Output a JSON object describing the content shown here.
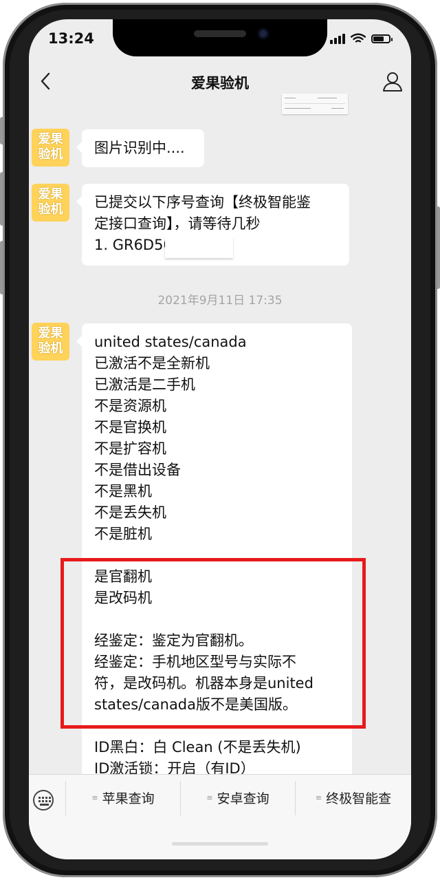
{
  "status_bar": {
    "time": "13:24",
    "battery_level": 0.7
  },
  "nav": {
    "title": "爱果验机",
    "back_icon": "chevron-left-icon",
    "profile_icon": "person-icon"
  },
  "avatar": {
    "line1": "爱果",
    "line2": "验机"
  },
  "messages": [
    {
      "lines": [
        "图片识别中...."
      ]
    },
    {
      "lines": [
        "已提交以下序号查询【终极智能鉴",
        "定接口查询】，请等待几秒",
        "1. GR6D50"
      ]
    },
    {
      "lines": [
        "united states/canada",
        "已激活不是全新机",
        "已激活是二手机",
        "不是资源机",
        "不是官换机",
        "不是扩容机",
        "不是借出设备",
        "不是黑机",
        "不是丢失机",
        "不是脏机",
        "",
        "是官翻机",
        "是改码机",
        "",
        "经鉴定：鉴定为官翻机。",
        "经鉴定：手机地区型号与实际不",
        "符，是改码机。机器本身是united",
        "states/canada版不是美国版。",
        "",
        "ID黑白：白 Clean (不是丢失机)",
        "ID激活锁：开启（有ID）"
      ]
    }
  ],
  "timestamp": "2021年9月11日 17:35",
  "bottom_menu": {
    "keyboard_icon": "keyboard-icon",
    "items": [
      "苹果查询",
      "安卓查询",
      "终极智能查"
    ]
  },
  "colors": {
    "highlight": "#e81a1a",
    "avatar_bg": "#ffd25a",
    "chat_bg": "#ededed"
  }
}
